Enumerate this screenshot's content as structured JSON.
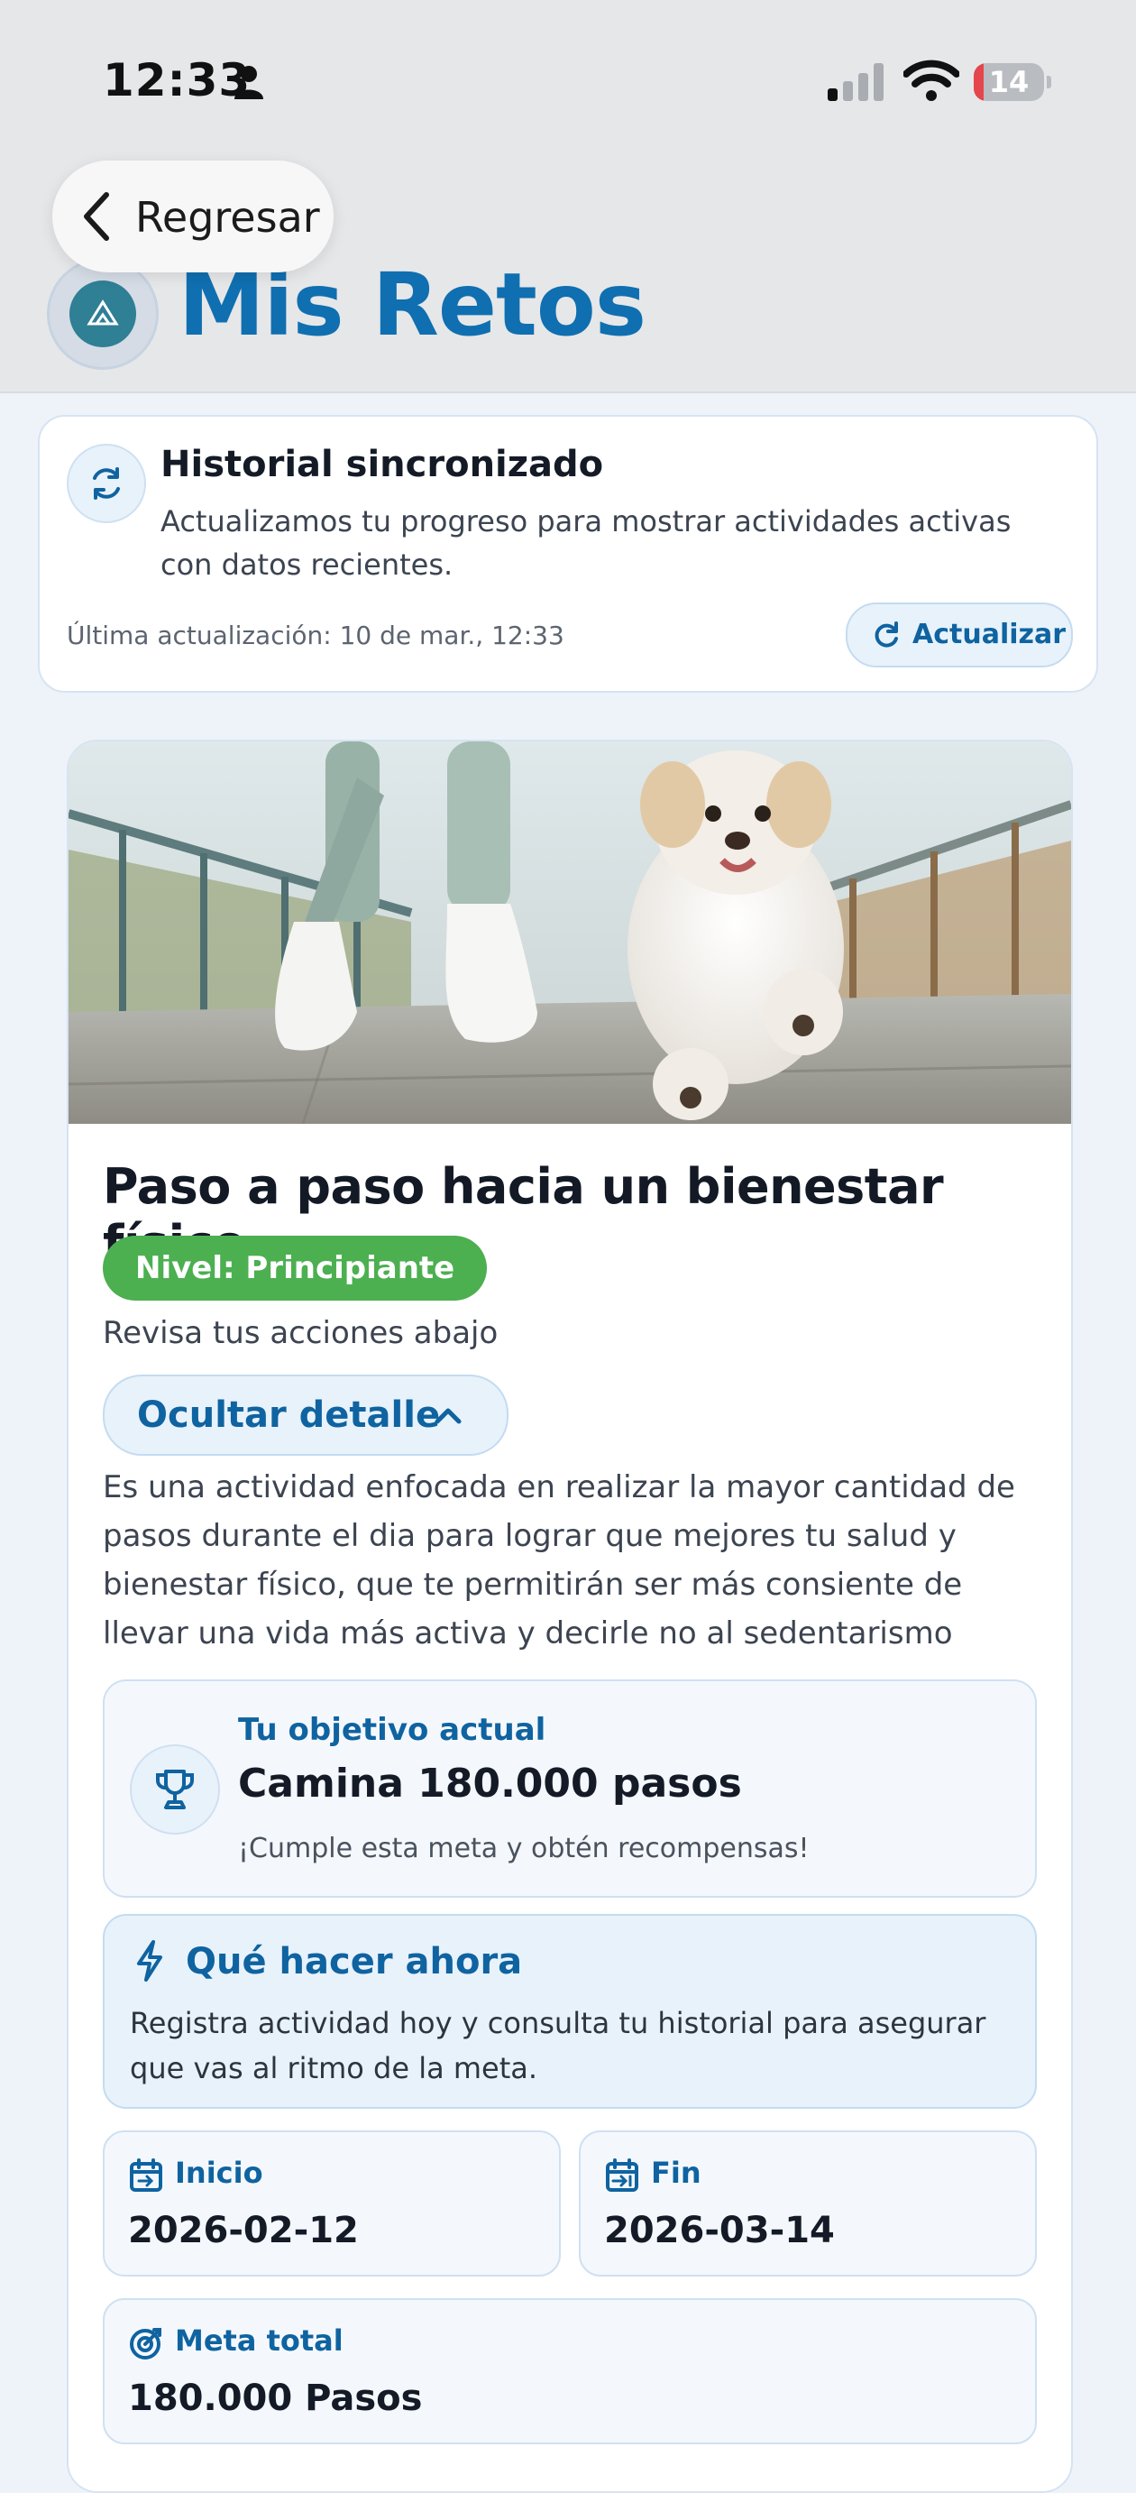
{
  "status_bar": {
    "time": "12:33",
    "battery_level": "14",
    "battery_fraction": 0.14,
    "battery_color": "#e5454c"
  },
  "header": {
    "back_label": "Regresar",
    "title": "Mis Retos",
    "title_color": "#0f6fb0",
    "background": "#e6e7e9"
  },
  "sync_card": {
    "icon": "sync-icon",
    "title": "Historial sincronizado",
    "description": "Actualizamos tu progreso para mostrar actividades activas con datos recientes.",
    "last_update": "Última actualización: 10 de mar., 12:33",
    "refresh_label": "Actualizar"
  },
  "challenge": {
    "image_alt": "Persona caminando con un perro",
    "title": "Paso a paso hacia un bienestar físico",
    "level": "Nivel: Principiante",
    "level_color": "#4caf50",
    "review_text": "Revisa tus acciones abajo",
    "toggle_label": "Ocultar detalle",
    "description": "Es una actividad enfocada en realizar la mayor cantidad de pasos durante el dia para lograr que mejores tu salud y bienestar físico, que te permitirán ser más consiente de llevar una vida más activa y decirle no al sedentarismo",
    "objective": {
      "icon": "trophy-icon",
      "label": "Tu objetivo actual",
      "value": "Camina 180.000 pasos",
      "note": "¡Cumple esta meta y obtén recompensas!"
    },
    "next_action": {
      "icon": "bolt-icon",
      "title": "Qué hacer ahora",
      "description": "Registra actividad hoy y consulta tu historial para asegurar que vas al ritmo de la meta."
    },
    "start": {
      "icon": "calendar-start-icon",
      "label": "Inicio",
      "value": "2026-02-12"
    },
    "end": {
      "icon": "calendar-end-icon",
      "label": "Fin",
      "value": "2026-03-14"
    },
    "total_goal": {
      "icon": "target-icon",
      "label": "Meta total",
      "value": "180.000 Pasos"
    }
  },
  "accent_color": "#0f63a0"
}
